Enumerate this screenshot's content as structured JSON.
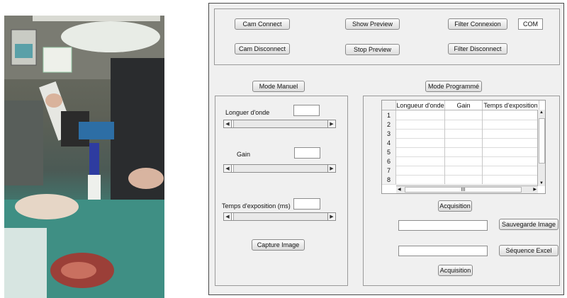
{
  "connection": {
    "cam_connect": "Cam Connect",
    "cam_disconnect": "Cam Disconnect",
    "show_preview": "Show Preview",
    "stop_preview": "Stop Preview",
    "filter_connexion": "Filter Connexion",
    "filter_disconnect": "Filter Disconnect",
    "com_port": "COM"
  },
  "modes": {
    "manual": "Mode Manuel",
    "programmed": "Mode Programmé"
  },
  "manual_panel": {
    "wavelength_label": "Longuer d'onde",
    "gain_label": "Gain",
    "exposure_label": "Temps d'exposition (ms)",
    "capture_button": "Capture Image"
  },
  "program_panel": {
    "table": {
      "columns": [
        "Longueur d'onde",
        "Gain",
        "Temps d'exposition"
      ],
      "row_numbers": [
        "1",
        "2",
        "3",
        "4",
        "5",
        "6",
        "7",
        "8"
      ],
      "hscroll_mark": "III"
    },
    "acquisition_top": "Acquisition",
    "save_image_button": "Sauvegarde Image",
    "excel_sequence_button": "Séquence Excel",
    "acquisition_bottom": "Acquisition"
  }
}
